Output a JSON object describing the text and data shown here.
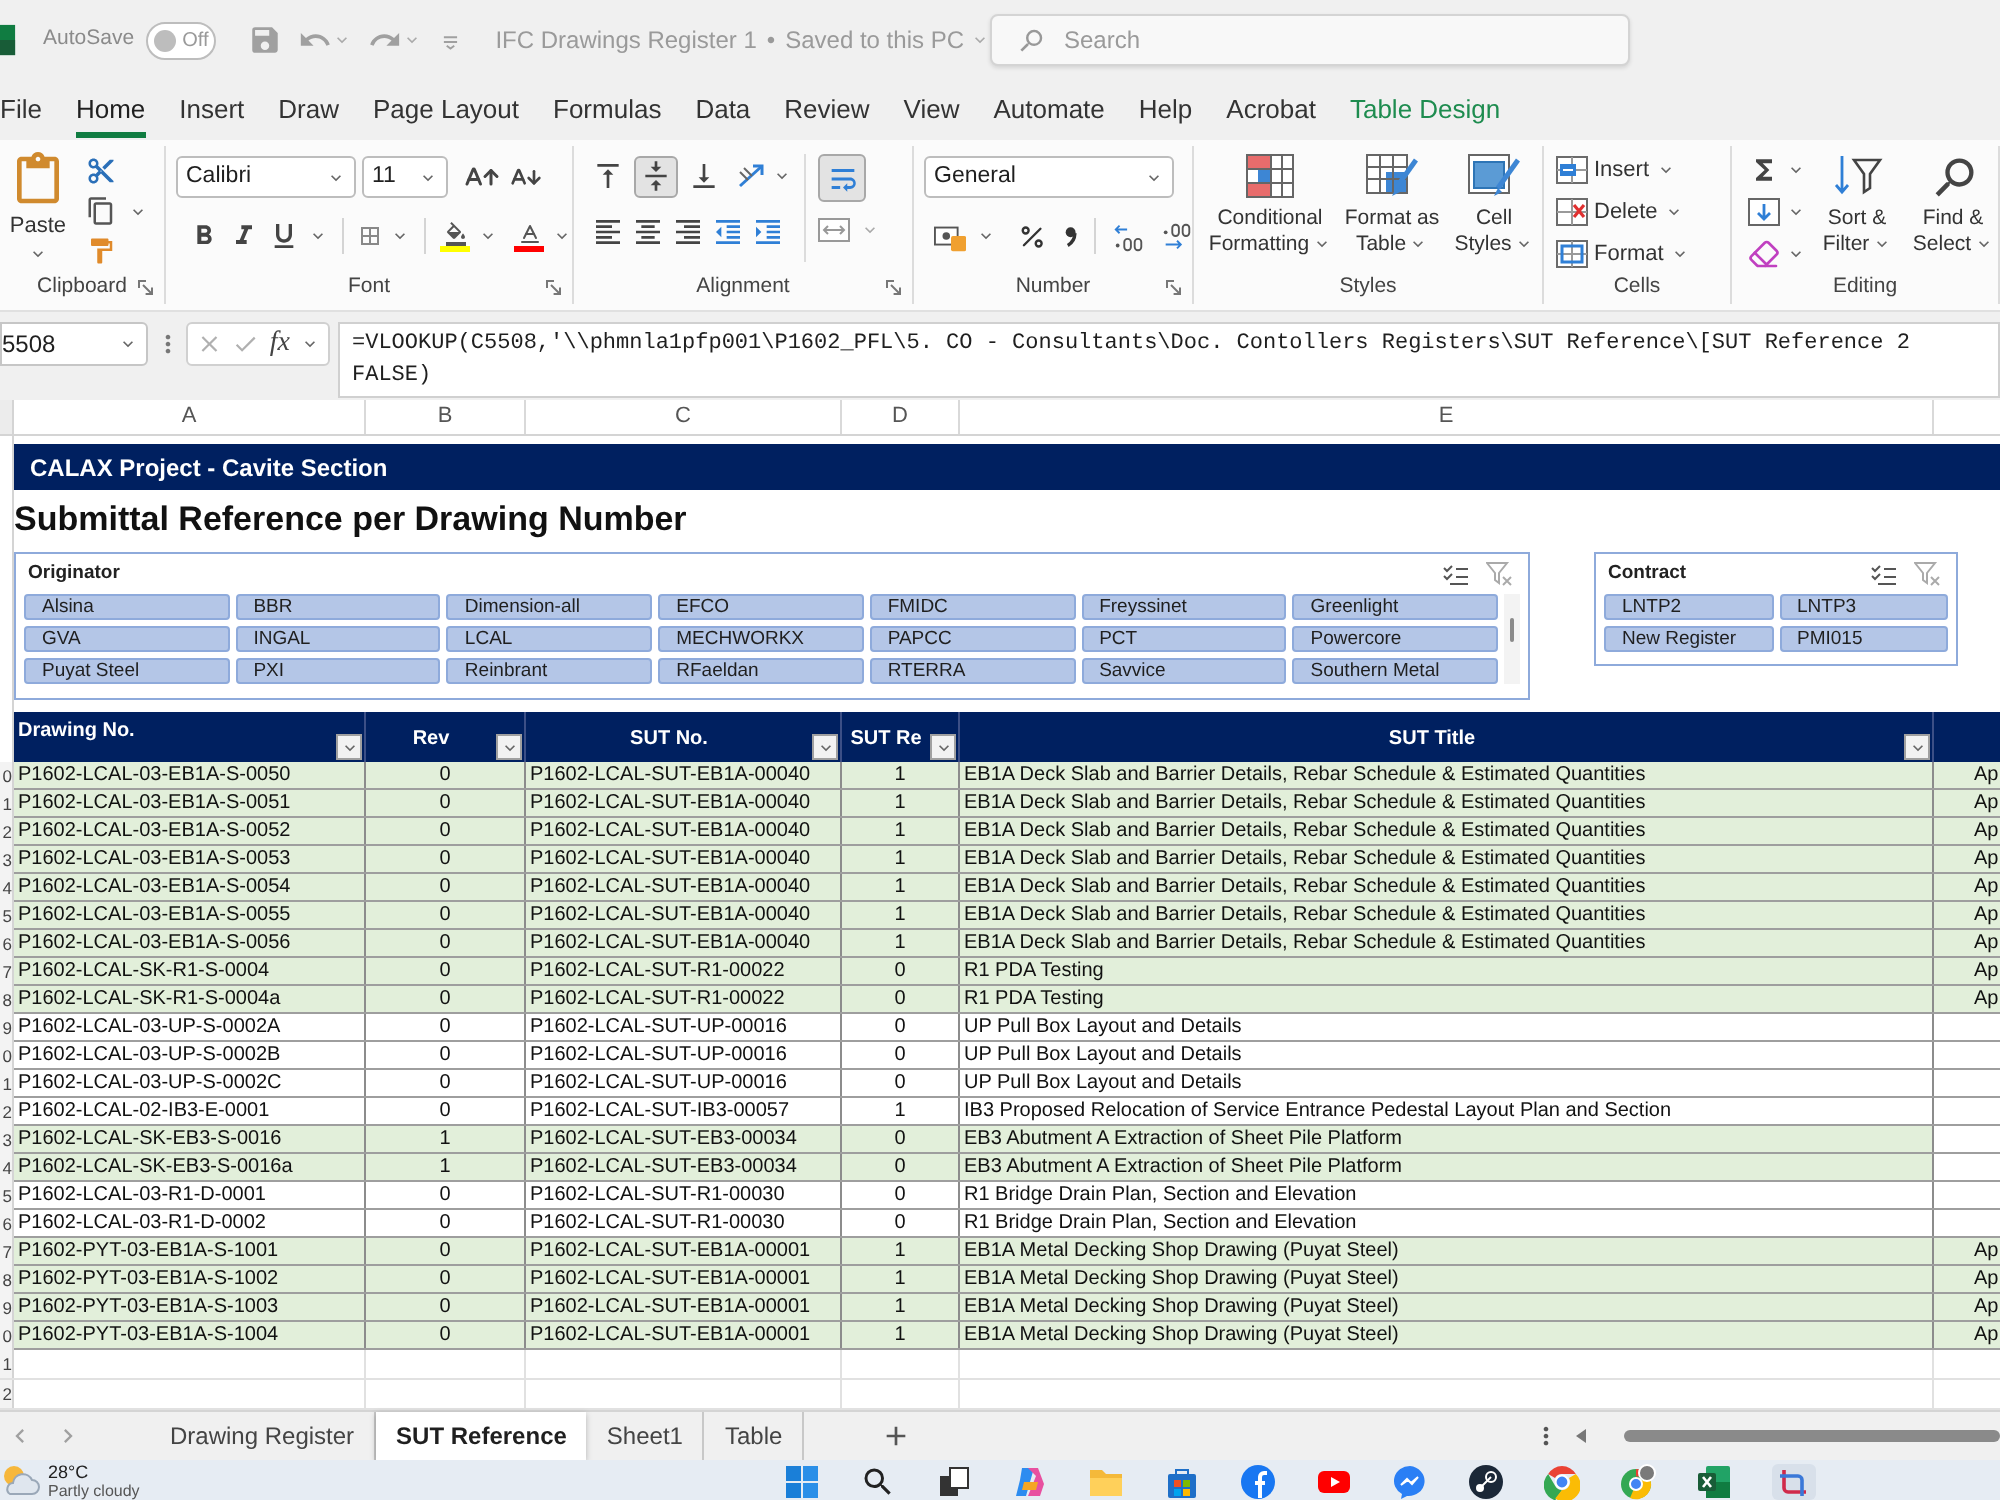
{
  "title_bar": {
    "autosave": {
      "label": "AutoSave",
      "on": false,
      "state_label": "Off"
    },
    "document": {
      "title": "IFC Drawings Register 1",
      "separator": "•",
      "status": "Saved to this PC"
    },
    "search": {
      "placeholder": "Search"
    }
  },
  "menu_tabs": [
    {
      "label": "File",
      "selected": false,
      "kind": "normal"
    },
    {
      "label": "Home",
      "selected": true,
      "kind": "normal"
    },
    {
      "label": "Insert",
      "selected": false,
      "kind": "normal"
    },
    {
      "label": "Draw",
      "selected": false,
      "kind": "normal"
    },
    {
      "label": "Page Layout",
      "selected": false,
      "kind": "normal"
    },
    {
      "label": "Formulas",
      "selected": false,
      "kind": "normal"
    },
    {
      "label": "Data",
      "selected": false,
      "kind": "normal"
    },
    {
      "label": "Review",
      "selected": false,
      "kind": "normal"
    },
    {
      "label": "View",
      "selected": false,
      "kind": "normal"
    },
    {
      "label": "Automate",
      "selected": false,
      "kind": "normal"
    },
    {
      "label": "Help",
      "selected": false,
      "kind": "normal"
    },
    {
      "label": "Acrobat",
      "selected": false,
      "kind": "normal"
    },
    {
      "label": "Table Design",
      "selected": false,
      "kind": "contextual"
    }
  ],
  "ribbon": {
    "clipboard": {
      "label": "Clipboard",
      "paste": "Paste"
    },
    "font": {
      "label": "Font",
      "font_name": "Calibri",
      "font_size": "11"
    },
    "alignment": {
      "label": "Alignment",
      "vertical": [
        {
          "kind": "top",
          "selected": false
        },
        {
          "kind": "middle",
          "selected": true
        },
        {
          "kind": "bottom",
          "selected": false
        }
      ],
      "wrap_text": {
        "selected": true
      }
    },
    "number": {
      "label": "Number",
      "format": "General"
    },
    "styles": {
      "label": "Styles",
      "buttons": [
        {
          "kind": "conditional",
          "label": "Conditional Formatting"
        },
        {
          "kind": "table",
          "label": "Format as Table"
        },
        {
          "kind": "cell",
          "label": "Cell Styles"
        }
      ]
    },
    "cells": {
      "label": "Cells",
      "buttons": [
        {
          "kind": "insert",
          "label": "Insert"
        },
        {
          "kind": "delete",
          "label": "Delete"
        },
        {
          "kind": "format",
          "label": "Format"
        }
      ]
    },
    "editing": {
      "label": "Editing",
      "buttons": [
        {
          "kind": "sort",
          "label": "Sort & Filter"
        },
        {
          "kind": "find",
          "label": "Find & Select"
        }
      ]
    }
  },
  "formula_bar": {
    "name_box": "5508",
    "insert_function": "fx",
    "formula_lines": [
      "=VLOOKUP(C5508,'\\\\phmnla1pfp001\\P1602_PFL\\5. CO - Consultants\\Doc. Contollers Registers\\SUT Reference\\[SUT Reference 2",
      "FALSE)"
    ]
  },
  "sheet": {
    "column_headers": [
      "A",
      "B",
      "C",
      "D",
      "E"
    ],
    "banner": "CALAX Project - Cavite Section",
    "heading": "Submittal Reference per Drawing Number",
    "slicers": [
      {
        "title": "Originator",
        "items": [
          {
            "label": "Alsina",
            "selected": true
          },
          {
            "label": "BBR",
            "selected": true
          },
          {
            "label": "Dimension-all",
            "selected": true
          },
          {
            "label": "EFCO",
            "selected": true
          },
          {
            "label": "FMIDC",
            "selected": true
          },
          {
            "label": "Freyssinet",
            "selected": true
          },
          {
            "label": "Greenlight",
            "selected": true
          },
          {
            "label": "GVA",
            "selected": true
          },
          {
            "label": "INGAL",
            "selected": true
          },
          {
            "label": "LCAL",
            "selected": true
          },
          {
            "label": "MECHWORKX",
            "selected": true
          },
          {
            "label": "PAPCC",
            "selected": true
          },
          {
            "label": "PCT",
            "selected": true
          },
          {
            "label": "Powercore",
            "selected": true
          },
          {
            "label": "Puyat Steel",
            "selected": true
          },
          {
            "label": "PXI",
            "selected": true
          },
          {
            "label": "Reinbrant",
            "selected": true
          },
          {
            "label": "RFaeldan",
            "selected": true
          },
          {
            "label": "RTERRA",
            "selected": true
          },
          {
            "label": "Savvice",
            "selected": true
          },
          {
            "label": "Southern Metal",
            "selected": true
          }
        ]
      },
      {
        "title": "Contract",
        "items": [
          {
            "label": "LNTP2",
            "selected": true
          },
          {
            "label": "LNTP3",
            "selected": true
          },
          {
            "label": "New Register",
            "selected": true
          },
          {
            "label": "PMI015",
            "selected": true
          }
        ]
      }
    ],
    "table": {
      "columns": [
        "Drawing No.",
        "Rev",
        "SUT No.",
        "SUT Re",
        "SUT Title"
      ],
      "rows": [
        {
          "row_header": "0",
          "drawing_no": "P1602-LCAL-03-EB1A-S-0050",
          "rev": "0",
          "sut_no": "P1602-LCAL-SUT-EB1A-00040",
          "sut_rev": "1",
          "sut_title": "EB1A Deck Slab and Barrier Details, Rebar Schedule & Estimated Quantities",
          "column_6": "Ap",
          "highlighted": true
        },
        {
          "row_header": "1",
          "drawing_no": "P1602-LCAL-03-EB1A-S-0051",
          "rev": "0",
          "sut_no": "P1602-LCAL-SUT-EB1A-00040",
          "sut_rev": "1",
          "sut_title": "EB1A Deck Slab and Barrier Details, Rebar Schedule & Estimated Quantities",
          "column_6": "Ap",
          "highlighted": true
        },
        {
          "row_header": "2",
          "drawing_no": "P1602-LCAL-03-EB1A-S-0052",
          "rev": "0",
          "sut_no": "P1602-LCAL-SUT-EB1A-00040",
          "sut_rev": "1",
          "sut_title": "EB1A Deck Slab and Barrier Details, Rebar Schedule & Estimated Quantities",
          "column_6": "Ap",
          "highlighted": true
        },
        {
          "row_header": "3",
          "drawing_no": "P1602-LCAL-03-EB1A-S-0053",
          "rev": "0",
          "sut_no": "P1602-LCAL-SUT-EB1A-00040",
          "sut_rev": "1",
          "sut_title": "EB1A Deck Slab and Barrier Details, Rebar Schedule & Estimated Quantities",
          "column_6": "Ap",
          "highlighted": true
        },
        {
          "row_header": "4",
          "drawing_no": "P1602-LCAL-03-EB1A-S-0054",
          "rev": "0",
          "sut_no": "P1602-LCAL-SUT-EB1A-00040",
          "sut_rev": "1",
          "sut_title": "EB1A Deck Slab and Barrier Details, Rebar Schedule & Estimated Quantities",
          "column_6": "Ap",
          "highlighted": true
        },
        {
          "row_header": "5",
          "drawing_no": "P1602-LCAL-03-EB1A-S-0055",
          "rev": "0",
          "sut_no": "P1602-LCAL-SUT-EB1A-00040",
          "sut_rev": "1",
          "sut_title": "EB1A Deck Slab and Barrier Details, Rebar Schedule & Estimated Quantities",
          "column_6": "Ap",
          "highlighted": true
        },
        {
          "row_header": "6",
          "drawing_no": "P1602-LCAL-03-EB1A-S-0056",
          "rev": "0",
          "sut_no": "P1602-LCAL-SUT-EB1A-00040",
          "sut_rev": "1",
          "sut_title": "EB1A Deck Slab and Barrier Details, Rebar Schedule & Estimated Quantities",
          "column_6": "Ap",
          "highlighted": true
        },
        {
          "row_header": "7",
          "drawing_no": "P1602-LCAL-SK-R1-S-0004",
          "rev": "0",
          "sut_no": "P1602-LCAL-SUT-R1-00022",
          "sut_rev": "0",
          "sut_title": "R1 PDA Testing",
          "column_6": "Ap",
          "highlighted": true
        },
        {
          "row_header": "8",
          "drawing_no": "P1602-LCAL-SK-R1-S-0004a",
          "rev": "0",
          "sut_no": "P1602-LCAL-SUT-R1-00022",
          "sut_rev": "0",
          "sut_title": "R1 PDA Testing",
          "column_6": "Ap",
          "highlighted": true
        },
        {
          "row_header": "9",
          "drawing_no": "P1602-LCAL-03-UP-S-0002A",
          "rev": "0",
          "sut_no": "P1602-LCAL-SUT-UP-00016",
          "sut_rev": "0",
          "sut_title": "UP Pull Box Layout and Details",
          "highlighted": false
        },
        {
          "row_header": "0",
          "drawing_no": "P1602-LCAL-03-UP-S-0002B",
          "rev": "0",
          "sut_no": "P1602-LCAL-SUT-UP-00016",
          "sut_rev": "0",
          "sut_title": "UP Pull Box Layout and Details",
          "highlighted": false
        },
        {
          "row_header": "1",
          "drawing_no": "P1602-LCAL-03-UP-S-0002C",
          "rev": "0",
          "sut_no": "P1602-LCAL-SUT-UP-00016",
          "sut_rev": "0",
          "sut_title": "UP Pull Box Layout and Details",
          "highlighted": false
        },
        {
          "row_header": "2",
          "drawing_no": "P1602-LCAL-02-IB3-E-0001",
          "rev": "0",
          "sut_no": "P1602-LCAL-SUT-IB3-00057",
          "sut_rev": "1",
          "sut_title": "IB3 Proposed Relocation of Service Entrance Pedestal Layout Plan and Section",
          "highlighted": false
        },
        {
          "row_header": "3",
          "drawing_no": "P1602-LCAL-SK-EB3-S-0016",
          "rev": "1",
          "sut_no": "P1602-LCAL-SUT-EB3-00034",
          "sut_rev": "0",
          "sut_title": "EB3 Abutment A Extraction of Sheet Pile Platform",
          "highlighted": true
        },
        {
          "row_header": "4",
          "drawing_no": "P1602-LCAL-SK-EB3-S-0016a",
          "rev": "1",
          "sut_no": "P1602-LCAL-SUT-EB3-00034",
          "sut_rev": "0",
          "sut_title": "EB3 Abutment A Extraction of Sheet Pile Platform",
          "highlighted": true
        },
        {
          "row_header": "5",
          "drawing_no": "P1602-LCAL-03-R1-D-0001",
          "rev": "0",
          "sut_no": "P1602-LCAL-SUT-R1-00030",
          "sut_rev": "0",
          "sut_title": "R1 Bridge Drain Plan, Section and Elevation",
          "highlighted": false
        },
        {
          "row_header": "6",
          "drawing_no": "P1602-LCAL-03-R1-D-0002",
          "rev": "0",
          "sut_no": "P1602-LCAL-SUT-R1-00030",
          "sut_rev": "0",
          "sut_title": "R1 Bridge Drain Plan, Section and Elevation",
          "highlighted": false
        },
        {
          "row_header": "7",
          "drawing_no": "P1602-PYT-03-EB1A-S-1001",
          "rev": "0",
          "sut_no": "P1602-LCAL-SUT-EB1A-00001",
          "sut_rev": "1",
          "sut_title": "EB1A Metal Decking Shop Drawing (Puyat Steel)",
          "column_6": "Ap",
          "highlighted": true
        },
        {
          "row_header": "8",
          "drawing_no": "P1602-PYT-03-EB1A-S-1002",
          "rev": "0",
          "sut_no": "P1602-LCAL-SUT-EB1A-00001",
          "sut_rev": "1",
          "sut_title": "EB1A Metal Decking Shop Drawing (Puyat Steel)",
          "column_6": "Ap",
          "highlighted": true
        },
        {
          "row_header": "9",
          "drawing_no": "P1602-PYT-03-EB1A-S-1003",
          "rev": "0",
          "sut_no": "P1602-LCAL-SUT-EB1A-00001",
          "sut_rev": "1",
          "sut_title": "EB1A Metal Decking Shop Drawing (Puyat Steel)",
          "column_6": "Ap",
          "highlighted": true
        },
        {
          "row_header": "0",
          "drawing_no": "P1602-PYT-03-EB1A-S-1004",
          "rev": "0",
          "sut_no": "P1602-LCAL-SUT-EB1A-00001",
          "sut_rev": "1",
          "sut_title": "EB1A Metal Decking Shop Drawing (Puyat Steel)",
          "column_6": "Ap",
          "highlighted": true
        }
      ]
    },
    "empty_rows": [
      {
        "row_header": "1"
      },
      {
        "row_header": "2"
      }
    ]
  },
  "sheet_tabs": [
    {
      "label": "Drawing Register",
      "selected": false
    },
    {
      "label": "SUT Reference",
      "selected": true
    },
    {
      "label": "Sheet1",
      "selected": false
    },
    {
      "label": "Table",
      "selected": false
    }
  ],
  "taskbar": {
    "weather": {
      "temperature": "28°C",
      "condition": "Partly cloudy"
    }
  }
}
